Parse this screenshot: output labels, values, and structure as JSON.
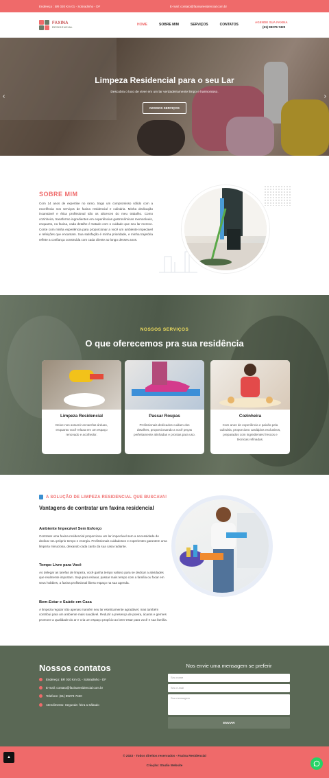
{
  "topbar": {
    "address": "Endereço : BR 020 Km 01 - Sobradinho - DF",
    "email": "E-mail: contato@faxinaresidencial.com.br"
  },
  "header": {
    "logo_title": "FAXINA",
    "logo_subtitle": "RESIDENCIAL",
    "nav": [
      "HOME",
      "SOBRE MIM",
      "SERVIÇOS",
      "CONTATOS"
    ],
    "cta_title": "AGENDE SUA FAXINA",
    "cta_phone": "(61) 99279-7420"
  },
  "hero": {
    "title": "Limpeza Residencial para o seu Lar",
    "subtitle": "Descubra o luxo de viver em um lar verdadeiramente limpo e harmonioso.",
    "button": "NOSSOS SERVIÇOS",
    "prev": "‹",
    "next": "›"
  },
  "about": {
    "title": "SOBRE MIM",
    "text": "Com 14 anos de expertise no ramo, trago um compromisso sólido com a excelência nos serviços de faxina residencial e culinária. Minha dedicação incansável e ética profissional são os alicerces do meu trabalho. Como cozinheira, transformo ingredientes em experiências gastronômicas memoráveis, enquanto, na faxina, cada detalhe é tratado com o cuidado que seu lar merece. Conte com minha experiência para proporcionar a você um ambiente impecável e refeições que encantam. Sua satisfação é minha prioridade, e minha trajetória reflete a confiança construída com cada cliente ao longo desses anos."
  },
  "services": {
    "kicker": "NOSSOS SERVIÇOS",
    "title": "O que oferecemos pra sua residência",
    "cards": [
      {
        "title": "Limpeza Residencial",
        "text": "Deixe-nos assumir as tarefas árduas, enquanto você relaxa em um espaço renovado e acolhedor."
      },
      {
        "title": "Passar Roupas",
        "text": "Profissionais dedicados cuidam dos detalhes, proporcionando a você peças perfeitamente alinhadas e prontas para uso."
      },
      {
        "title": "Cozinheira",
        "text": "Com anos de experiência e paixão pela culinária, proporciono cardápios exclusivos, preparados com ingredientes frescos e técnicas refinadas."
      }
    ]
  },
  "advantages": {
    "kicker": "A SOLUÇÃO DE LIMPEZA RESIDENCIAL QUE BUSCAVA!",
    "title": "Vantagens de contratar um faxina residencial",
    "items": [
      {
        "title": "Ambiente Impecável Sem Esforço",
        "text": "Contratar uma faxina residencial proporciona um lar impecável sem a necessidade de dedicar seu próprio tempo e energia. Profissionais cuidadosos e experientes garantem uma limpeza minuciosa, deixando cada canto da sua casa radiante."
      },
      {
        "title": "Tempo Livre para Você",
        "text": "Ao delegar as tarefas de limpeza, você ganha tempo valioso para se dedicar a atividades que realmente importam. Seja para relaxar, passar mais tempo com a família ou focar em seus hobbies, a faxina profissional libera espaço na sua agenda."
      },
      {
        "title": "Bem-Estar e Saúde em Casa",
        "text": "A limpeza regular não apenas mantém seu lar esteticamente agradável, mas também contribui para um ambiente mais saudável. Reduzir a presença de poeira, ácaros e germes promove a qualidade do ar e cria um espaço propício ao bem-estar para você e sua família."
      }
    ]
  },
  "contact": {
    "title": "Nossos contatos",
    "address": "Endereço: BR 020 Km 01 - Sobradinho - DF",
    "email": "E-mail: contato@faxinaresidencial.com.br",
    "phone": "Telefone: (61) 99279-7420",
    "hours": "Atendimento: Segunda- feira a Sábado",
    "form_title": "Nos envie uma mensagem se preferir",
    "name_placeholder": "Seu nome",
    "email_placeholder": "Seu e-mail",
    "message_placeholder": "Sua mensagem",
    "send": "ENVIAR"
  },
  "footer": {
    "copyright": "© 2023 - Todos direitos reservados - Faxina Residencial",
    "credit": "Criação: Studio Website",
    "top_icon": "chevron-up-icon",
    "whatsapp_icon": "whatsapp-icon"
  },
  "colors": {
    "accent": "#ef6a6a",
    "green": "#5a6855",
    "yellow": "#f3e05d"
  }
}
